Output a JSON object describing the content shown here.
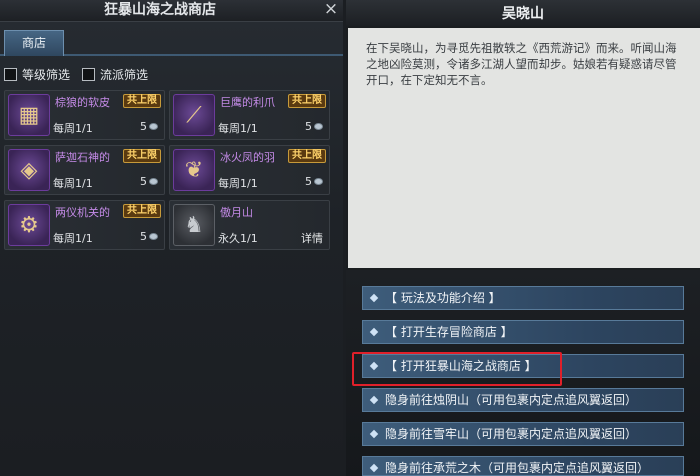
{
  "shop": {
    "title": "狂暴山海之战商店",
    "close_label": "×",
    "tabs": [
      {
        "label": "商店"
      }
    ],
    "filters": [
      {
        "label": "等级筛选"
      },
      {
        "label": "流派筛选"
      }
    ],
    "items": [
      {
        "name": "棕狼的软皮",
        "limit": "共上限",
        "period": "每周1/1",
        "cost": "5",
        "icon": "leather-icon"
      },
      {
        "name": "巨鹰的利爪",
        "limit": "共上限",
        "period": "每周1/1",
        "cost": "5",
        "icon": "claw-icon"
      },
      {
        "name": "萨迦石神的",
        "limit": "共上限",
        "period": "每周1/1",
        "cost": "5",
        "icon": "stone-core-icon"
      },
      {
        "name": "冰火凤的羽",
        "limit": "共上限",
        "period": "每周1/1",
        "cost": "5",
        "icon": "feather-icon"
      },
      {
        "name": "两仪机关的",
        "limit": "共上限",
        "period": "每周1/1",
        "cost": "5",
        "icon": "gear-icon"
      },
      {
        "name": "傲月山",
        "limit": "",
        "period": "永久1/1",
        "cost": "详情",
        "icon": "wolf-mount-icon"
      }
    ]
  },
  "npc": {
    "name": "吴晓山",
    "dialog": "在下吴晓山，为寻觅先祖散轶之《西荒游记》而来。听闻山海之地凶险莫测，令诸多江湖人望而却步。姑娘若有疑惑请尽管开口，在下定知无不言。",
    "options": [
      "【 玩法及功能介绍 】",
      "【 打开生存冒险商店 】",
      "【 打开狂暴山海之战商店 】",
      "隐身前往烛阴山（可用包裹内定点追风翼返回）",
      "隐身前往雪牢山（可用包裹内定点追风翼返回）",
      "隐身前往承荒之木（可用包裹内定点追风翼返回）"
    ]
  },
  "colors": {
    "highlight": "#e0202a",
    "item_name": "#c58be8",
    "limit_badge": "#ffd36b",
    "option_bg": "#3e5d7b"
  }
}
